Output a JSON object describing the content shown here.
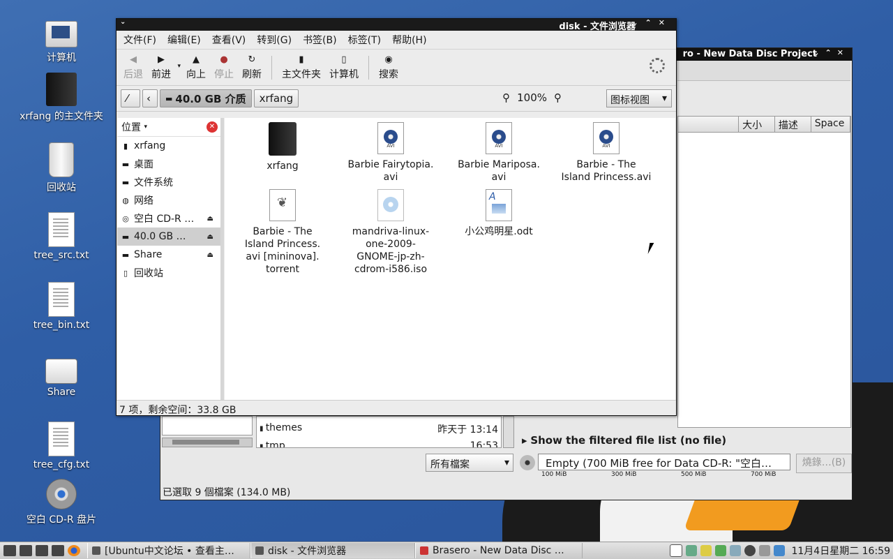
{
  "desktop": {
    "icons": [
      {
        "label": "计算机",
        "icon": "computer-icon"
      },
      {
        "label": "xrfang 的主文件夹",
        "icon": "home-folder-icon"
      },
      {
        "label": "回收站",
        "icon": "trash-icon"
      },
      {
        "label": "tree_src.txt",
        "icon": "text-file-icon"
      },
      {
        "label": "tree_bin.txt",
        "icon": "text-file-icon"
      },
      {
        "label": "Share",
        "icon": "drive-icon"
      },
      {
        "label": "tree_cfg.txt",
        "icon": "text-file-icon"
      },
      {
        "label": "空白 CD-R 盘片",
        "icon": "cd-icon"
      }
    ]
  },
  "brasero": {
    "title": "ro - New Data Disc Project",
    "columns": [
      "大小",
      "描述",
      "Space"
    ],
    "files": [
      {
        "name": "themes",
        "time": "昨天于 13:14"
      },
      {
        "name": "tmp",
        "time": "16:53"
      }
    ],
    "filter_label": "Show the filtered file list (no file)",
    "file_type": "所有檔案",
    "disc_status": "Empty (700 MiB free for Data CD-R: \"空白…",
    "burn_label": "燒錄…(B)",
    "scale": [
      "100 MiB",
      "300 MiB",
      "500 MiB",
      "700 MiB"
    ],
    "status": "已選取 9 個檔案 (134.0 MB)"
  },
  "nautilus": {
    "title": "disk - 文件浏览器",
    "menu": [
      "文件(F)",
      "编辑(E)",
      "查看(V)",
      "转到(G)",
      "书签(B)",
      "标签(T)",
      "帮助(H)"
    ],
    "toolbar": {
      "back": "后退",
      "forward": "前进",
      "up": "向上",
      "stop": "停止",
      "reload": "刷新",
      "home": "主文件夹",
      "computer": "计算机",
      "search": "搜索"
    },
    "location": {
      "path_current": "40.0 GB 介质",
      "path_next": "xrfang",
      "zoom": "100%",
      "view_mode": "图标视图"
    },
    "sidebar": {
      "header": "位置",
      "items": [
        {
          "label": "xrfang",
          "icon": "folder-icon",
          "eject": false
        },
        {
          "label": "桌面",
          "icon": "desktop-icon",
          "eject": false
        },
        {
          "label": "文件系统",
          "icon": "drive-icon",
          "eject": false
        },
        {
          "label": "网络",
          "icon": "network-icon",
          "eject": false
        },
        {
          "label": "空白 CD-R …",
          "icon": "cd-icon",
          "eject": true
        },
        {
          "label": "40.0 GB …",
          "icon": "drive-icon",
          "eject": true
        },
        {
          "label": "Share",
          "icon": "drive-icon",
          "eject": true
        },
        {
          "label": "回收站",
          "icon": "trash-icon",
          "eject": false
        }
      ]
    },
    "files": [
      {
        "name": "xrfang",
        "type": "folder"
      },
      {
        "name": "Barbie Fairytopia.\navi",
        "type": "avi"
      },
      {
        "name": "Barbie Mariposa.\navi",
        "type": "avi"
      },
      {
        "name": "Barbie - The\nIsland Princess.avi",
        "type": "avi"
      },
      {
        "name": "Barbie - The\nIsland Princess.\navi [mininova].\ntorrent",
        "type": "torrent"
      },
      {
        "name": "mandriva-linux-\none-2009-\nGNOME-jp-zh-\ncdrom-i586.iso",
        "type": "iso"
      },
      {
        "name": "小公鸡明星.odt",
        "type": "odt"
      }
    ],
    "status": "7 项，剩余空间：33.8 GB"
  },
  "taskbar": {
    "tasks": [
      "[Ubuntu中文论坛 • 查看主…",
      "disk - 文件浏览器",
      "Brasero - New Data Disc …"
    ],
    "clock": "11月4日星期二 16:59"
  }
}
